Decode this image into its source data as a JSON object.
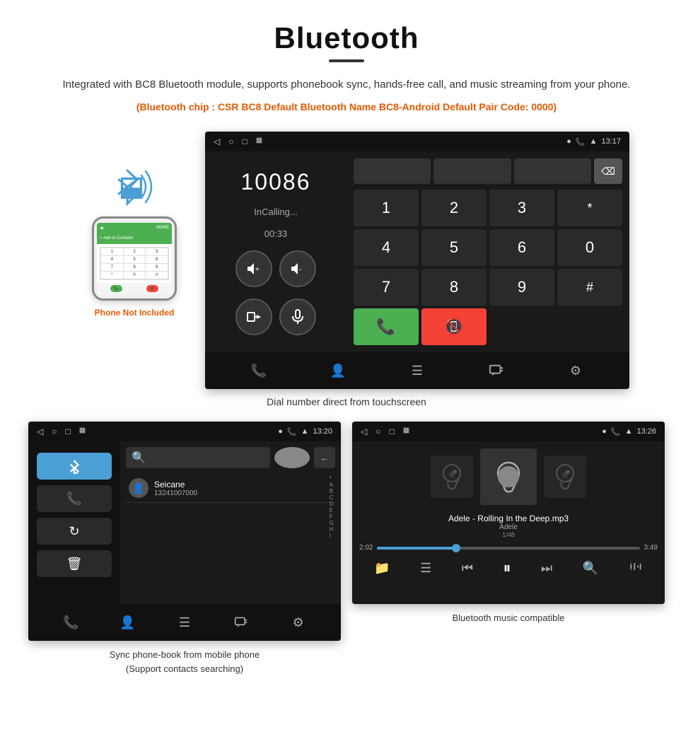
{
  "title": "Bluetooth",
  "description": "Integrated with BC8 Bluetooth module, supports phonebook sync, hands-free call, and music streaming from your phone.",
  "spec_info": "(Bluetooth chip : CSR BC8    Default Bluetooth Name BC8-Android    Default Pair Code: 0000)",
  "dial_screen": {
    "status_time": "13:17",
    "number": "10086",
    "call_status": "InCalling...",
    "timer": "00:33",
    "keypad": [
      "1",
      "2",
      "3",
      "*",
      "4",
      "5",
      "6",
      "0",
      "7",
      "8",
      "9",
      "#"
    ],
    "call_btn": "📞",
    "end_btn": "📵"
  },
  "dial_caption": "Dial number direct from touchscreen",
  "phonebook_screen": {
    "status_time": "13:20",
    "contact_name": "Seicane",
    "contact_phone": "13241007000",
    "alphabet": [
      "*",
      "A",
      "B",
      "C",
      "D",
      "E",
      "F",
      "G",
      "H",
      "I"
    ]
  },
  "phonebook_caption": "Sync phone-book from mobile phone\n(Support contacts searching)",
  "music_screen": {
    "status_time": "13:26",
    "song_title": "Adele - Rolling In the Deep.mp3",
    "artist": "Adele",
    "track_count": "1/48",
    "time_current": "2:02",
    "time_total": "3:49"
  },
  "music_caption": "Bluetooth music compatible",
  "phone_not_included": "Phone Not Included"
}
